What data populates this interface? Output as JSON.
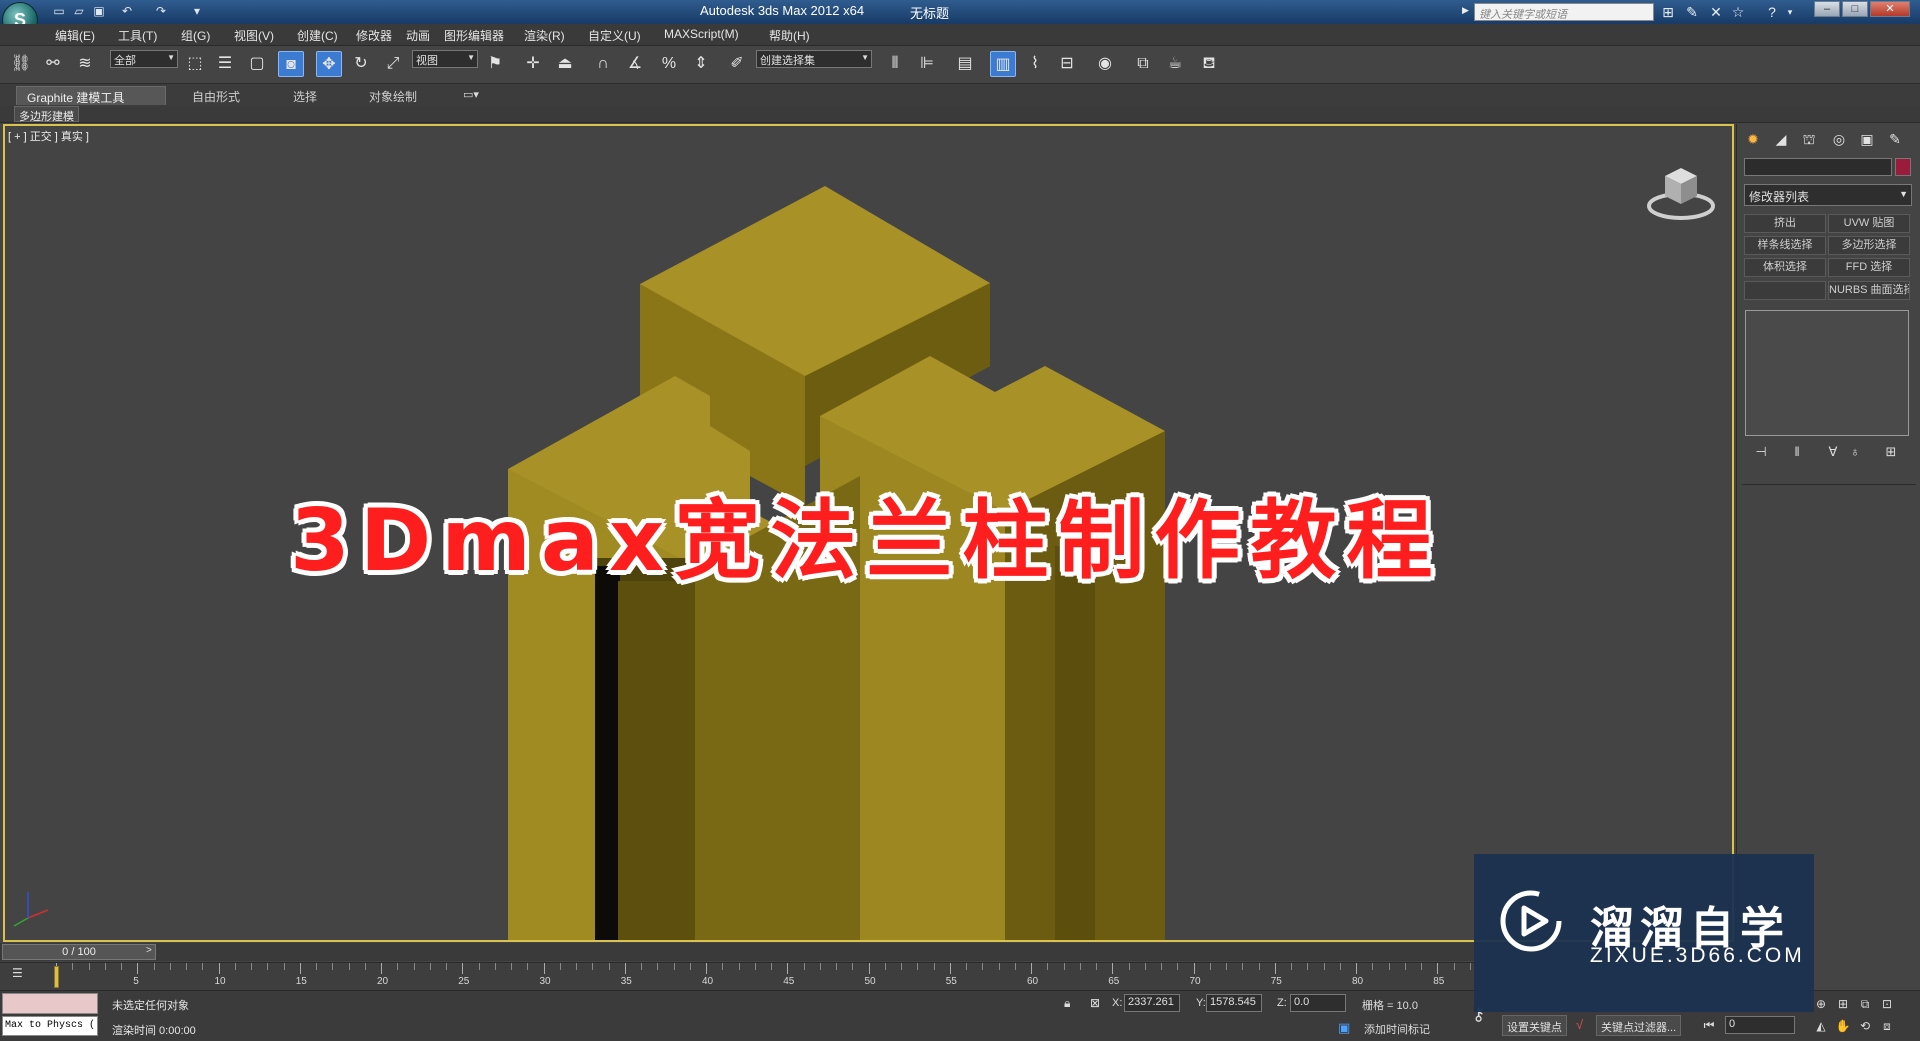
{
  "title_bar": {
    "app_title": "Autodesk 3ds Max  2012 x64",
    "doc_title": "无标题",
    "search_placeholder": "键入关键字或短语"
  },
  "menu": [
    "编辑(E)",
    "工具(T)",
    "组(G)",
    "视图(V)",
    "创建(C)",
    "修改器",
    "动画",
    "图形编辑器",
    "渲染(R)",
    "自定义(U)",
    "MAXScript(M)",
    "帮助(H)"
  ],
  "toolbar": {
    "selection_filter": "全部",
    "ref_coord": "视图",
    "named_selection": "创建选择集"
  },
  "ribbon": {
    "tabs": [
      "Graphite 建模工具",
      "自由形式",
      "选择",
      "对象绘制"
    ],
    "sub_label": "多边形建模"
  },
  "viewport": {
    "label": "[ + ] 正交 ] 真实 ]"
  },
  "command_panel": {
    "modifier_list": "修改器列表",
    "buttons": [
      "挤出",
      "UVW 贴图",
      "样条线选择",
      "多边形选择",
      "体积选择",
      "FFD 选择",
      "",
      "NURBS 曲面选择"
    ]
  },
  "timeline": {
    "slider_text": "0 / 100",
    "ticks": [
      5,
      10,
      15,
      20,
      25,
      30,
      35,
      40,
      45,
      50,
      55,
      60,
      65,
      70,
      75,
      80,
      85
    ],
    "current_frame": 0
  },
  "status": {
    "selection": "未选定任何对象",
    "render_time": "渲染时间  0:00:00",
    "maxscript": "Max to Physcs (",
    "x_label": "X:",
    "x_value": "2337.261",
    "y_label": "Y:",
    "y_value": "1578.545",
    "z_label": "Z:",
    "z_value": "0.0",
    "grid": "栅格 = 10.0",
    "add_time_tag": "添加时间标记",
    "set_key": "设置关键点",
    "key_filters": "关键点过滤器...",
    "frame": "0"
  },
  "overlay": {
    "banner": "3Dmax宽法兰柱制作教程",
    "watermark_cn": "溜溜自学",
    "watermark_en": "ZIXUE.3D66.COM"
  },
  "colors": {
    "viewport_bg": "#444444",
    "object_yellow": "#a38c25",
    "banner_red": "#ff1e1e",
    "watermark_bg": "#1b3250"
  }
}
